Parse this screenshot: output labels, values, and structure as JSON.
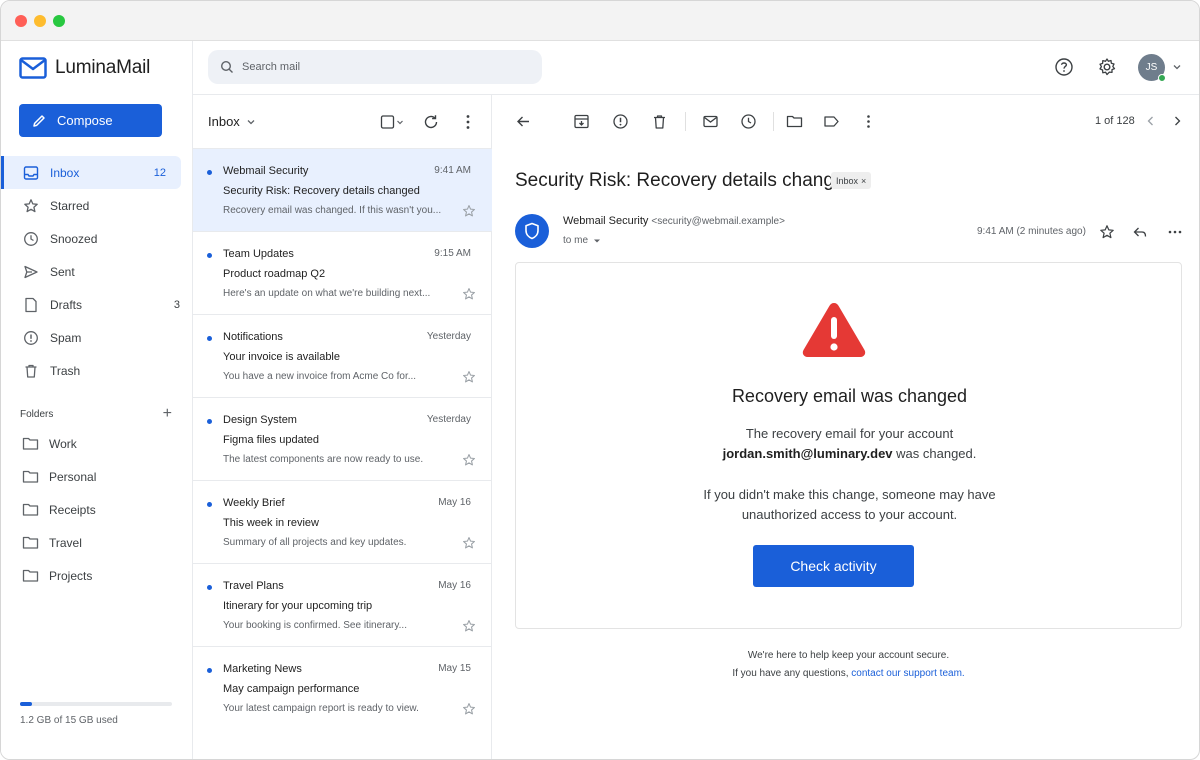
{
  "app": {
    "name": "LuminaMail"
  },
  "colors": {
    "accent": "#1a5fd9",
    "warning": "#e53935",
    "selected_bg": "#e8f0fe"
  },
  "sidebar": {
    "compose_label": "Compose",
    "items": [
      {
        "label": "Inbox",
        "icon": "inbox-icon",
        "count": "12",
        "active": true
      },
      {
        "label": "Starred",
        "icon": "star-icon",
        "count": ""
      },
      {
        "label": "Snoozed",
        "icon": "clock-icon",
        "count": ""
      },
      {
        "label": "Sent",
        "icon": "send-icon",
        "count": ""
      },
      {
        "label": "Drafts",
        "icon": "draft-icon",
        "count": "3"
      },
      {
        "label": "Spam",
        "icon": "spam-icon",
        "count": ""
      },
      {
        "label": "Trash",
        "icon": "trash-icon",
        "count": ""
      }
    ],
    "folders_title": "Folders",
    "folders": [
      "Work",
      "Personal",
      "Receipts",
      "Travel",
      "Projects"
    ],
    "storage_text": "1.2 GB of 15 GB used",
    "storage_fraction": 0.08
  },
  "search": {
    "placeholder": "Search mail"
  },
  "user": {
    "initials": "JS"
  },
  "list": {
    "title": "Inbox",
    "messages": [
      {
        "sender": "Webmail Security",
        "time": "9:41 AM",
        "subject": "Security Risk: Recovery details changed",
        "preview": "Recovery email was changed. If this wasn't you...",
        "unread": true,
        "selected": true
      },
      {
        "sender": "Team Updates",
        "time": "9:15 AM",
        "subject": "Product roadmap Q2",
        "preview": "Here's an update on what we're building next...",
        "unread": true
      },
      {
        "sender": "Notifications",
        "time": "Yesterday",
        "subject": "Your invoice is available",
        "preview": "You have a new invoice from Acme Co for...",
        "unread": true
      },
      {
        "sender": "Design System",
        "time": "Yesterday",
        "subject": "Figma files updated",
        "preview": "The latest components are now ready to use.",
        "unread": true
      },
      {
        "sender": "Weekly Brief",
        "time": "May 16",
        "subject": "This week in review",
        "preview": "Summary of all projects and key updates.",
        "unread": true
      },
      {
        "sender": "Travel Plans",
        "time": "May 16",
        "subject": "Itinerary for your upcoming trip",
        "preview": "Your booking is confirmed. See itinerary...",
        "unread": true
      },
      {
        "sender": "Marketing News",
        "time": "May 15",
        "subject": "May campaign performance",
        "preview": "Your latest campaign report is ready to view.",
        "unread": true
      }
    ]
  },
  "reader": {
    "pager": "1 of 128",
    "subject": "Security Risk: Recovery details changed",
    "label_chip": "Inbox",
    "chip_close": "×",
    "from_name": "Webmail Security",
    "from_email": "<security@webmail.example>",
    "to": "to me",
    "time": "9:41 AM (2 minutes ago)",
    "card": {
      "title": "Recovery email was changed",
      "p1_a": "The recovery email for your account",
      "p1_email": "jordan.smith@luminary.dev",
      "p1_b": " was changed.",
      "p2_a": "If you didn't make this change, someone may have",
      "p2_b": "unauthorized access to your account.",
      "button": "Check activity"
    },
    "footer_1": "We're here to help keep your account secure.",
    "footer_2": "If you have any questions, ",
    "footer_link": "contact our support team."
  }
}
